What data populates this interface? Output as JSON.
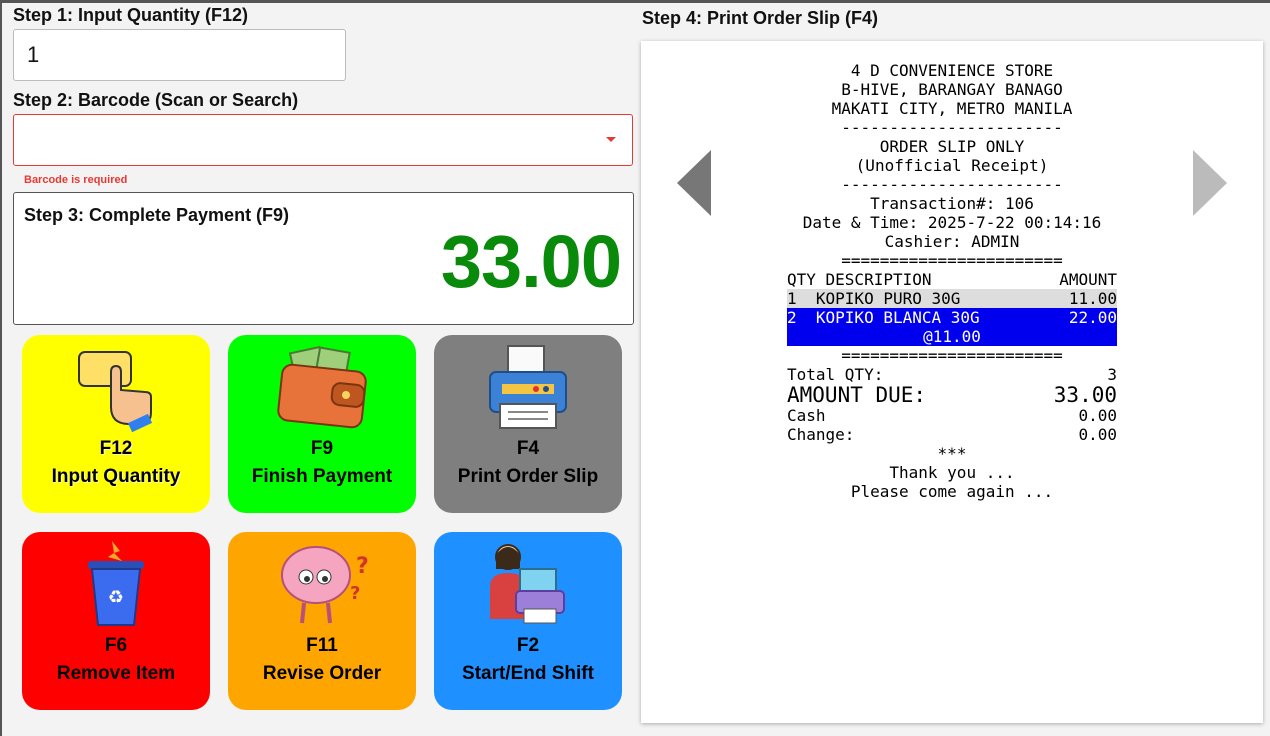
{
  "step1": {
    "label": "Step 1: Input Quantity (F12)",
    "value": "1"
  },
  "step2": {
    "label": "Step 2: Barcode (Scan or Search)",
    "value": "",
    "error": "Barcode is required"
  },
  "step3": {
    "label": "Step 3: Complete Payment (F9)",
    "amount": "33.00"
  },
  "step4": {
    "label": "Step 4: Print Order Slip (F4)"
  },
  "tiles": [
    {
      "key": "F12",
      "label": "Input Quantity",
      "color": "#ffff00",
      "icon": "hand-pointer-icon"
    },
    {
      "key": "F9",
      "label": "Finish Payment",
      "color": "#00ff00",
      "icon": "wallet-icon"
    },
    {
      "key": "F4",
      "label": "Print Order Slip",
      "color": "#7f7f7f",
      "icon": "printer-icon"
    },
    {
      "key": "F6",
      "label": "Remove Item",
      "color": "#ff0000",
      "icon": "trash-bin-icon"
    },
    {
      "key": "F11",
      "label": "Revise Order",
      "color": "#ffa500",
      "icon": "brain-question-icon"
    },
    {
      "key": "F2",
      "label": "Start/End Shift",
      "color": "#1e90ff",
      "icon": "cashier-printer-icon"
    }
  ],
  "receipt": {
    "store": "4 D CONVENIENCE STORE",
    "address1": "B-HIVE, BARANGAY BANAGO",
    "address2": "MAKATI CITY, METRO MANILA",
    "dash": "-----------------------",
    "slip_title": "ORDER SLIP ONLY",
    "slip_sub": "(Unofficial Receipt)",
    "transaction": "Transaction#: 106",
    "datetime": "Date & Time: 2025-7-22 00:14:16",
    "cashier": "Cashier: ADMIN",
    "equals": "=======================",
    "col_left": "QTY DESCRIPTION",
    "col_right": "AMOUNT",
    "items": [
      {
        "desc": "1  KOPIKO PURO 30G",
        "amount": "11.00"
      },
      {
        "desc": "2  KOPIKO BLANCA 30G",
        "amount": "22.00",
        "unit": "@11.00"
      }
    ],
    "total_qty_label": "Total QTY:",
    "total_qty": "3",
    "due_label": "AMOUNT DUE:",
    "due": "33.00",
    "cash_label": "Cash",
    "cash": "0.00",
    "change_label": "Change:",
    "change": "0.00",
    "stars": "***",
    "thanks": "Thank you ...",
    "again": "Please come again ..."
  }
}
